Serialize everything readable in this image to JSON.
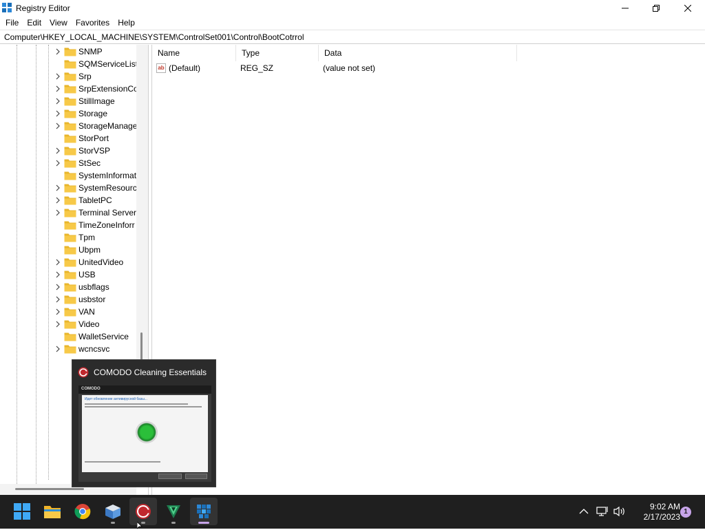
{
  "window": {
    "title": "Registry Editor",
    "controls": {
      "minimize": "minimize",
      "maximize": "restore",
      "close": "close"
    }
  },
  "menu": [
    "File",
    "Edit",
    "View",
    "Favorites",
    "Help"
  ],
  "address": "Computer\\HKEY_LOCAL_MACHINE\\SYSTEM\\ControlSet001\\Control\\BootCotrrol",
  "tree": {
    "items": [
      {
        "label": "SNMP",
        "expandable": true
      },
      {
        "label": "SQMServiceList",
        "expandable": false
      },
      {
        "label": "Srp",
        "expandable": true
      },
      {
        "label": "SrpExtensionCo",
        "expandable": true
      },
      {
        "label": "StillImage",
        "expandable": true
      },
      {
        "label": "Storage",
        "expandable": true
      },
      {
        "label": "StorageManage",
        "expandable": true
      },
      {
        "label": "StorPort",
        "expandable": false
      },
      {
        "label": "StorVSP",
        "expandable": true
      },
      {
        "label": "StSec",
        "expandable": true
      },
      {
        "label": "SystemInformat",
        "expandable": false
      },
      {
        "label": "SystemResource",
        "expandable": true
      },
      {
        "label": "TabletPC",
        "expandable": true
      },
      {
        "label": "Terminal Server",
        "expandable": true
      },
      {
        "label": "TimeZoneInforr",
        "expandable": false
      },
      {
        "label": "Tpm",
        "expandable": false
      },
      {
        "label": "Ubpm",
        "expandable": false
      },
      {
        "label": "UnitedVideo",
        "expandable": true
      },
      {
        "label": "USB",
        "expandable": true
      },
      {
        "label": "usbflags",
        "expandable": true
      },
      {
        "label": "usbstor",
        "expandable": true
      },
      {
        "label": "VAN",
        "expandable": true
      },
      {
        "label": "Video",
        "expandable": true
      },
      {
        "label": "WalletService",
        "expandable": false
      },
      {
        "label": "wcncsvc",
        "expandable": true
      }
    ]
  },
  "list": {
    "columns": [
      "Name",
      "Type",
      "Data"
    ],
    "rows": [
      {
        "name": "(Default)",
        "type": "REG_SZ",
        "data": "(value not set)",
        "icon": "string-value-icon"
      }
    ]
  },
  "preview": {
    "title": "COMODO Cleaning Essentials",
    "icon": "comodo-icon",
    "thumbnail": {
      "brand": "COMODO",
      "heading": "Идет обновление антивирусной базы...",
      "accent": "#2bbf3a"
    }
  },
  "taskbar": {
    "apps": [
      {
        "name": "start",
        "icon": "windows-logo-icon"
      },
      {
        "name": "file-explorer",
        "icon": "folder-icon"
      },
      {
        "name": "chrome",
        "icon": "chrome-icon"
      },
      {
        "name": "sandbox",
        "icon": "box-icon"
      },
      {
        "name": "comodo-cleaning-essentials",
        "icon": "comodo-icon"
      },
      {
        "name": "vpn-shield",
        "icon": "shield-icon"
      },
      {
        "name": "registry-editor",
        "icon": "registry-icon"
      }
    ],
    "time": "9:02 AM",
    "date": "2/17/2023",
    "notifications": "1"
  },
  "colors": {
    "folder": "#f7c948",
    "taskbar": "#1f1f1f",
    "active_indicator": "#c7a4e9"
  }
}
